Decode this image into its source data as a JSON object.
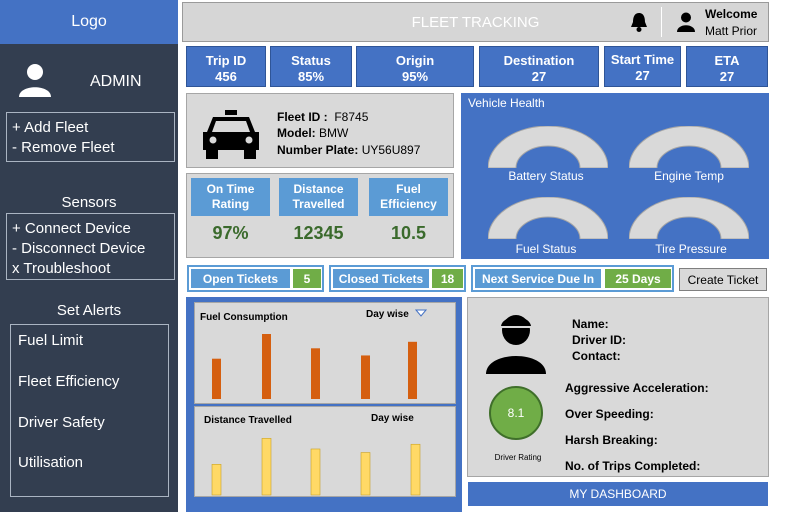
{
  "sidebar": {
    "logo": "Logo",
    "admin": "ADMIN",
    "fleet_actions": [
      "+ Add Fleet",
      "- Remove Fleet"
    ],
    "sensors_title": "Sensors",
    "sensor_actions": [
      "+ Connect Device",
      "- Disconnect Device",
      "x Troubleshoot"
    ],
    "alerts_title": "Set Alerts",
    "alerts": [
      "Fuel Limit",
      "Fleet Efficiency",
      "Driver Safety",
      "Utilisation"
    ]
  },
  "header": {
    "title": "FLEET TRACKING",
    "welcome": "Welcome",
    "user": "Matt Prior"
  },
  "stats": [
    {
      "label": "Trip ID",
      "value": "456"
    },
    {
      "label": "Status",
      "value": "85%"
    },
    {
      "label": "Origin",
      "value": "95%"
    },
    {
      "label": "Destination",
      "value": "27"
    },
    {
      "label": "Start Time",
      "value": "27"
    },
    {
      "label": "ETA",
      "value": "27"
    }
  ],
  "fleet": {
    "id_label": "Fleet ID :",
    "id": "F8745",
    "model_label": "Model:",
    "model": "BMW",
    "plate_label": "Number Plate:",
    "plate": "UY56U897"
  },
  "metrics": [
    {
      "label": "On Time Rating",
      "value": "97%"
    },
    {
      "label": "Distance Travelled",
      "value": "12345"
    },
    {
      "label": "Fuel Efficiency",
      "value": "10.5"
    }
  ],
  "health": {
    "title": "Vehicle Health",
    "gauges": [
      "Battery Status",
      "Engine Temp",
      "Fuel Status",
      "Tire Pressure"
    ]
  },
  "tickets": {
    "open_label": "Open Tickets",
    "open_count": "5",
    "closed_label": "Closed Tickets",
    "closed_count": "18",
    "service_label": "Next Service Due In",
    "service_value": "25 Days",
    "create_label": "Create Ticket"
  },
  "charts": {
    "fuel_title": "Fuel Consumption",
    "fuel_filter": "Day wise",
    "distance_title": "Distance Travelled",
    "distance_filter": "Day wise",
    "fuel_color": "#d55f10",
    "distance_color": "#ffd966"
  },
  "chart_data": [
    {
      "type": "bar",
      "title": "Fuel Consumption",
      "values": [
        0.62,
        1.0,
        0.78,
        0.67,
        0.88
      ],
      "color": "#d55f10"
    },
    {
      "type": "bar",
      "title": "Distance Travelled",
      "values": [
        0.52,
        0.96,
        0.78,
        0.72,
        0.86
      ],
      "color": "#ffd966"
    }
  ],
  "driver": {
    "name_label": "Name:",
    "id_label": "Driver ID:",
    "contact_label": "Contact:",
    "rating": "8.1",
    "rating_label": "Driver Rating",
    "aggressive": "Aggressive Acceleration:",
    "speeding": "Over Speeding:",
    "braking": "Harsh Breaking:",
    "trips": "No. of Trips Completed:"
  },
  "footer": {
    "dashboard": "MY DASHBOARD"
  }
}
